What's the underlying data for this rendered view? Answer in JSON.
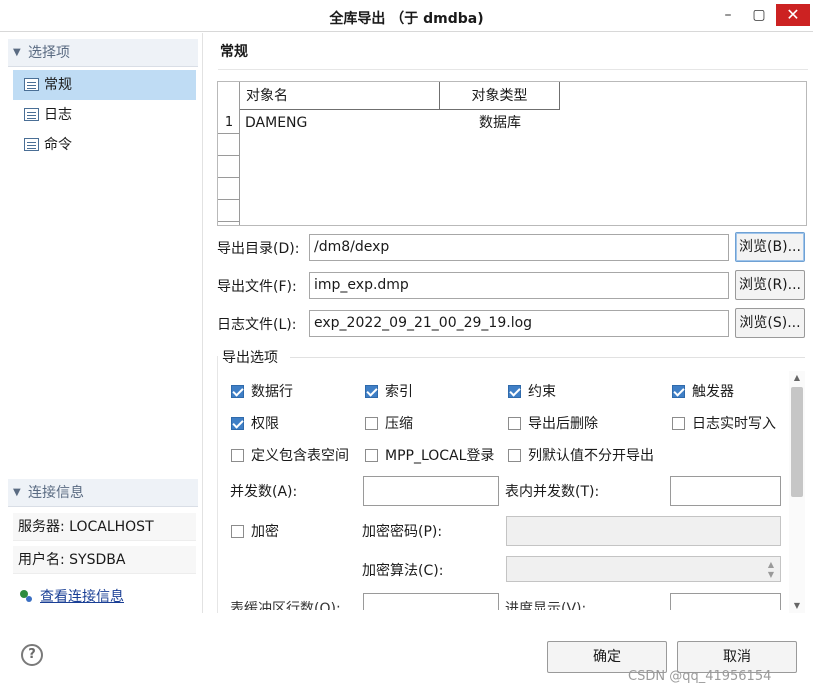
{
  "window": {
    "title": "全库导出 （于 dmdba)",
    "minimize": "–",
    "maximize": "▢",
    "close": "✕"
  },
  "sidebar": {
    "section1": {
      "title": "选择项",
      "items": [
        {
          "label": "常规",
          "selected": true
        },
        {
          "label": "日志"
        },
        {
          "label": "命令"
        }
      ]
    },
    "section2": {
      "title": "连接信息",
      "server": "服务器: LOCALHOST",
      "user": "用户名: SYSDBA",
      "link": "查看连接信息"
    }
  },
  "main": {
    "title": "常规",
    "grid": {
      "columns": [
        "对象名",
        "对象类型"
      ],
      "rows": [
        {
          "num": "1",
          "name": "DAMENG",
          "type": "数据库"
        }
      ]
    },
    "fields": {
      "dir": {
        "label": "导出目录(D):",
        "value": "/dm8/dexp",
        "browse": "浏览(B)..."
      },
      "file": {
        "label": "导出文件(F):",
        "value": "imp_exp.dmp",
        "browse": "浏览(R)..."
      },
      "log": {
        "label": "日志文件(L):",
        "value": "exp_2022_09_21_00_29_19.log",
        "browse": "浏览(S)..."
      }
    },
    "options": {
      "title": "导出选项",
      "checkboxes": [
        {
          "label": "数据行",
          "checked": true
        },
        {
          "label": "索引",
          "checked": true
        },
        {
          "label": "约束",
          "checked": true
        },
        {
          "label": "触发器",
          "checked": true
        },
        {
          "label": "权限",
          "checked": true
        },
        {
          "label": "压缩",
          "checked": false
        },
        {
          "label": "导出后删除",
          "checked": false
        },
        {
          "label": "日志实时写入",
          "checked": false
        },
        {
          "label": "定义包含表空间",
          "checked": false
        },
        {
          "label": "MPP_LOCAL登录",
          "checked": false
        },
        {
          "label": "列默认值不分开导出",
          "checked": false
        }
      ],
      "parallel": "并发数(A):",
      "table_parallel": "表内并发数(T):",
      "encrypt": {
        "label": "加密",
        "checked": false
      },
      "encrypt_password": "加密密码(P):",
      "encrypt_algo": "加密算法(C):",
      "partial_row1": "表缓冲区行数(O):",
      "partial_row2": "进度显示(V):"
    }
  },
  "footer": {
    "help": "?",
    "ok": "确定",
    "cancel": "取消",
    "watermark": "CSDN @qq_41956154"
  }
}
